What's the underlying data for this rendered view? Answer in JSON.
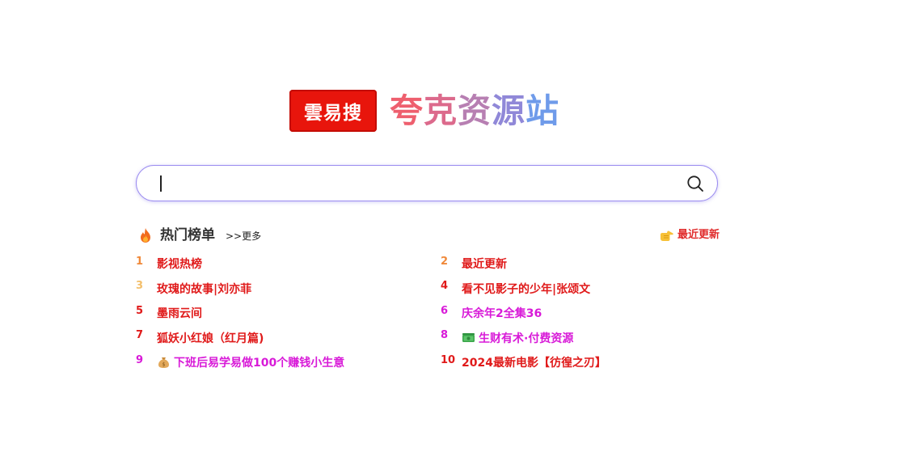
{
  "brand": {
    "logo_text": "雲易搜",
    "title": "夸克资源站",
    "title_colors": [
      "#ee5f6e",
      "#dc6a8c",
      "#b77fb2",
      "#9088d8",
      "#6f9bea"
    ]
  },
  "search": {
    "value": "",
    "placeholder": "",
    "border_color": "#9b8cf0"
  },
  "hot": {
    "title": "热门榜单",
    "more": ">>更多",
    "latest_label": "最近更新",
    "items": [
      {
        "rank": "1",
        "label": "影视热榜",
        "rank_color": "#f0893a",
        "label_color": "#e01a1a",
        "icon": ""
      },
      {
        "rank": "2",
        "label": "最近更新",
        "rank_color": "#f0893a",
        "label_color": "#e01a1a",
        "icon": ""
      },
      {
        "rank": "3",
        "label": "玫瑰的故事|刘亦菲",
        "rank_color": "#f3bf6b",
        "label_color": "#e01a1a",
        "icon": ""
      },
      {
        "rank": "4",
        "label": "看不见影子的少年|张颂文",
        "rank_color": "#e01a1a",
        "label_color": "#e01a1a",
        "icon": ""
      },
      {
        "rank": "5",
        "label": "墨雨云间",
        "rank_color": "#e01a1a",
        "label_color": "#e01a1a",
        "icon": ""
      },
      {
        "rank": "6",
        "label": "庆余年2全集36",
        "rank_color": "#d81ad8",
        "label_color": "#d81ad8",
        "icon": ""
      },
      {
        "rank": "7",
        "label": "狐妖小红娘（红月篇)",
        "rank_color": "#e01a1a",
        "label_color": "#e01a1a",
        "icon": ""
      },
      {
        "rank": "8",
        "label": "生财有术·付费资源",
        "rank_color": "#d81ad8",
        "label_color": "#d81ad8",
        "icon": "money-bills-icon"
      },
      {
        "rank": "9",
        "label": "下班后易学易做100个赚钱小生意",
        "rank_color": "#d81ad8",
        "label_color": "#d81ad8",
        "icon": "money-bag-icon"
      },
      {
        "rank": "10",
        "label": "2024最新电影【彷徨之刃】",
        "rank_color": "#e01a1a",
        "label_color": "#e01a1a",
        "icon": ""
      }
    ]
  }
}
